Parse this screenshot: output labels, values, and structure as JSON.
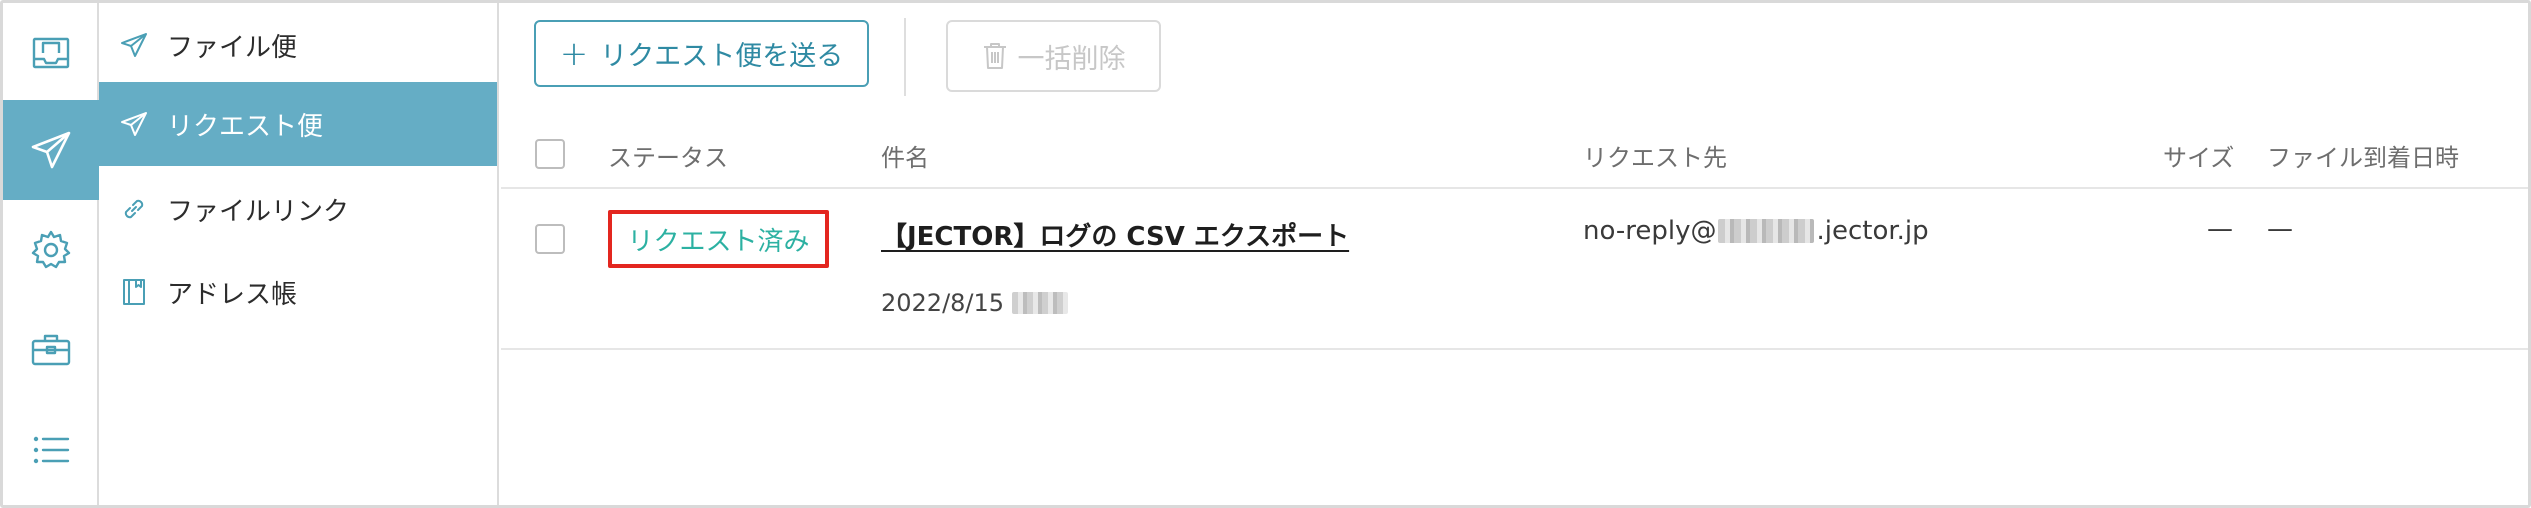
{
  "rail": {
    "items": [
      {
        "icon": "inbox-icon",
        "active": false
      },
      {
        "icon": "paper-plane-icon",
        "active": true
      },
      {
        "icon": "gear-icon",
        "active": false
      },
      {
        "icon": "toolbox-icon",
        "active": false
      },
      {
        "icon": "list-icon",
        "active": false
      }
    ],
    "accent_color": "#65adc5"
  },
  "submenu": {
    "items": [
      {
        "label": "ファイル便",
        "icon": "send-icon",
        "active": false
      },
      {
        "label": "リクエスト便",
        "icon": "send-icon",
        "active": true
      },
      {
        "label": "ファイルリンク",
        "icon": "link-icon",
        "active": false
      },
      {
        "label": "アドレス帳",
        "icon": "book-icon",
        "active": false
      }
    ]
  },
  "toolbar": {
    "request_button_label": "リクエスト便を送る",
    "delete_button_label": "一括削除"
  },
  "table": {
    "headers": {
      "status": "ステータス",
      "subject": "件名",
      "recipient": "リクエスト先",
      "size": "サイズ",
      "arrival": "ファイル到着日時"
    },
    "rows": [
      {
        "status": "リクエスト済み",
        "subject": "【JECTOR】ログの CSV エクスポート",
        "date": "2022/8/15",
        "recipient_prefix": "no-reply@",
        "recipient_suffix": ".jector.jp",
        "size": "—",
        "arrival": "—"
      }
    ]
  },
  "colors": {
    "status_text": "#2cb1a2",
    "highlight_border": "#e3261f",
    "primary_button": "#2f8aa3"
  }
}
